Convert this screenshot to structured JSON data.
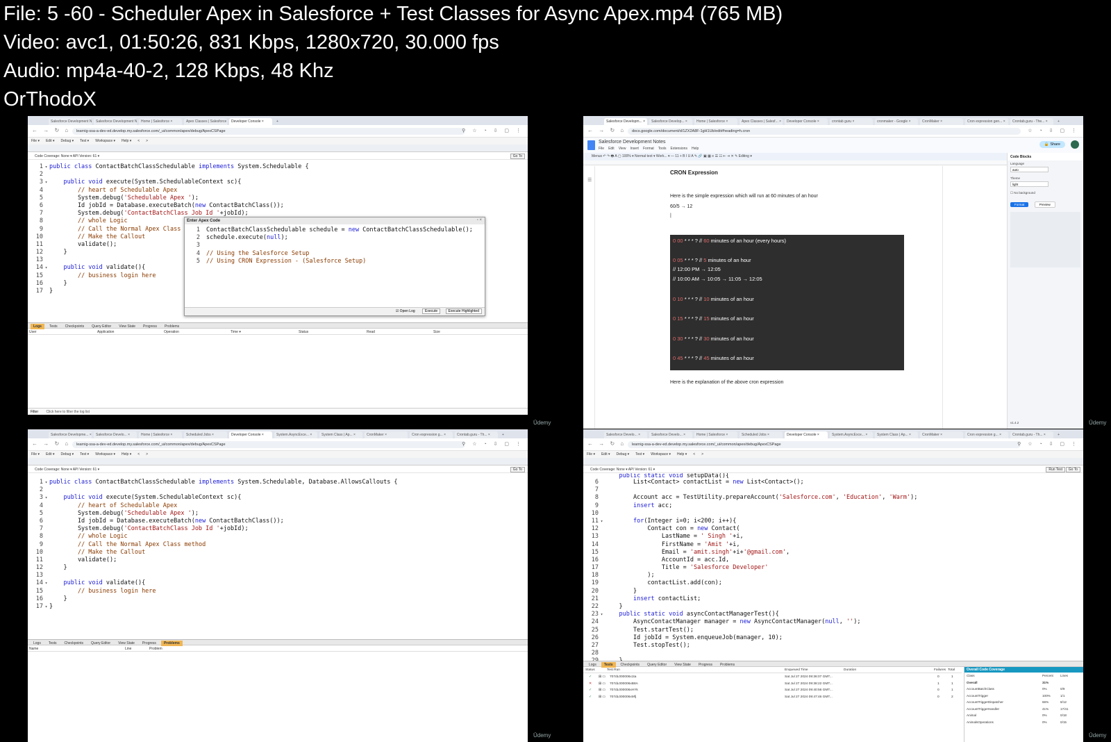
{
  "header": {
    "file": "File: 5 -60 - Scheduler Apex in Salesforce + Test Classes for Async Apex.mp4 (765 MB)",
    "video": "Video: avc1, 01:50:26, 831 Kbps, 1280x720, 30.000 fps",
    "audio": "Audio: mp4a-40-2, 128 Kbps, 48 Khz",
    "author": "OrThodoX"
  },
  "watermark": "Ūdemy",
  "console": {
    "url": "learnig-ssa-a-dev-ed.develop.my.salesforce.com/_ui/common/apex/debug/ApexCSPage",
    "menu": [
      "File ▾",
      "Edit ▾",
      "Debug ▾",
      "Test ▾",
      "Workspace ▾",
      "Help ▾",
      "<",
      ">"
    ],
    "coverage": "Code Coverage: None ▾   API Version:  61 ▾",
    "goto": "Go To",
    "run_test": "Run Test",
    "bottom_tabs": [
      "Logs",
      "Tests",
      "Checkpoints",
      "Query Editor",
      "View State",
      "Progress",
      "Problems"
    ]
  },
  "tl": {
    "tabs": [
      "Salesforce Development N...",
      "Salesforce Development Not...",
      "Home | Salesforce",
      "Apex Classes | Salesforce",
      "Developer Console"
    ],
    "files": [
      "AccountBatchClass.apex",
      "ContactBatchClass.apex",
      "AsyncContactManager.apex",
      "ContactBatchClassSchedulable.apex"
    ],
    "code": [
      {
        "n": "1",
        "f": "▾",
        "t": "<span class='kw'>public class</span> ContactBatchClassSchedulable <span class='kw'>implements</span> System.Schedulable {"
      },
      {
        "n": "2",
        "f": "",
        "t": ""
      },
      {
        "n": "3",
        "f": "▾",
        "t": "    <span class='kw'>public void</span> execute(System.SchedulableContext sc){"
      },
      {
        "n": "4",
        "f": "",
        "t": "        <span class='cm'>// heart of Schedulable Apex</span>"
      },
      {
        "n": "5",
        "f": "",
        "t": "        System.debug(<span class='st'>'Schedulable Apex '</span>);"
      },
      {
        "n": "6",
        "f": "",
        "t": "        Id jobId = Database.executeBatch(<span class='kw'>new</span> ContactBatchClass());"
      },
      {
        "n": "7",
        "f": "",
        "t": "        System.debug(<span class='st'>'ContactBatchClass Job Id '</span>+jobId);"
      },
      {
        "n": "8",
        "f": "",
        "t": "        <span class='cm'>// whole Logic</span>"
      },
      {
        "n": "9",
        "f": "",
        "t": "        <span class='cm'>// Call the Normal Apex Class m</span>"
      },
      {
        "n": "10",
        "f": "",
        "t": "        <span class='cm'>// Make the Callout</span>"
      },
      {
        "n": "11",
        "f": "",
        "t": "        validate();"
      },
      {
        "n": "12",
        "f": "",
        "t": "    }"
      },
      {
        "n": "13",
        "f": "",
        "t": ""
      },
      {
        "n": "14",
        "f": "▾",
        "t": "    <span class='kw'>public void</span> validate(){"
      },
      {
        "n": "15",
        "f": "",
        "t": "        <span class='cm'>// business login here</span>"
      },
      {
        "n": "16",
        "f": "",
        "t": "    }"
      },
      {
        "n": "17",
        "f": "",
        "t": "}"
      }
    ],
    "dialog": {
      "title": "Enter Apex Code",
      "code": [
        {
          "n": "1",
          "f": "",
          "t": "ContactBatchClassSchedulable schedule = <span class='kw'>new</span> ContactBatchClassSchedulable();"
        },
        {
          "n": "2",
          "f": "",
          "t": "schedule.execute(<span class='kw'>null</span>);"
        },
        {
          "n": "3",
          "f": "",
          "t": ""
        },
        {
          "n": "4",
          "f": "",
          "t": "<span class='cm'>// Using the Salesforce Setup</span>"
        },
        {
          "n": "5",
          "f": "",
          "t": "<span class='cm'>// Using CRON Expression - (Salesforce Setup)</span>"
        }
      ],
      "open_log": "☑ Open Log",
      "execute": "Execute",
      "execute_highlighted": "Execute Highlighted"
    },
    "log_cols": [
      "User",
      "Application",
      "Operation",
      "Time ▾",
      "Status",
      "Read",
      "Size"
    ],
    "filter": "Filter",
    "filter_hint": "Click here to filter the log list"
  },
  "tr": {
    "tabs": [
      "Salesforce Developm...",
      "Salesforce Develop...",
      "Home | Salesforce",
      "Apex Classes | Salesf...",
      "Developer Console",
      "crontab guru",
      "cronmaker - Google",
      "CronMaker",
      "Cron expression gen...",
      "Crontab.guru - The..."
    ],
    "url": "docs.google.com/document/d/1ZX2A8F-1gH1Ub/edit#heading=h.cron",
    "doc_title": "Salesforce Development Notes",
    "doc_menu": [
      "File",
      "Edit",
      "View",
      "Insert",
      "Format",
      "Tools",
      "Extensions",
      "Help"
    ],
    "share": "Share",
    "toolbar": "Menus   ↶  ↷  🖶  A  ▢   100% ▾    Normal text ▾    Work... ▾   — 11 +   B  I  U  A  ✎   🔗  ▣  ▦   ≡  ☰  ☷  ⇤  ⇥  ✕           ✎ Editing ▾",
    "heading": "CRON Expression",
    "p1": "Here is the simple expression which will run at 60 minutes of an hour",
    "p2": "60/5 → 12",
    "cron": [
      {
        "pre": "0 00",
        "mid": " * * * ? // ",
        "num": "60",
        "post": " minutes of an hour (every hours)"
      },
      {
        "pre": "0 05",
        "mid": " * * * ? // ",
        "num": "5",
        "post": " minutes of an hour"
      },
      {
        "pre": "",
        "mid": "// 12:00 PM → 12:05",
        "num": "",
        "post": ""
      },
      {
        "pre": "",
        "mid": "// 10:00 AM → 10:05 → 11:05 → 12:05",
        "num": "",
        "post": ""
      },
      {
        "pre": "0 10",
        "mid": " * * * ? // ",
        "num": "10",
        "post": " minutes of an hour"
      },
      {
        "pre": "0 15",
        "mid": " * * * ? // ",
        "num": "15",
        "post": " minutes of an hour"
      },
      {
        "pre": "0 30",
        "mid": " * * * ? // ",
        "num": "30",
        "post": " minutes of an hour"
      },
      {
        "pre": "0 45",
        "mid": " * * * ? // ",
        "num": "45",
        "post": " minutes of an hour"
      }
    ],
    "p3": "Here is the explanation of the above cron expression",
    "panel": {
      "title": "Code Blocks",
      "language_label": "Language",
      "language": "auto",
      "theme_label": "Theme",
      "theme": "light",
      "no_bg": "No background",
      "format": "Format",
      "preview": "Preview",
      "version": "v1.4.2"
    }
  },
  "bl": {
    "tabs": [
      "Salesforce Developme...",
      "Salesforce Develo...",
      "Home | Salesforce",
      "Scheduled Jobs",
      "Developer Console",
      "System.AsyncExce...",
      "System Class | Ap...",
      "CronMaker",
      "Cron expression g...",
      "Crontab.guru - Th..."
    ],
    "files": [
      "AccountBatchClass.apex",
      "ContactBatchClass.apex",
      "AsyncContactManager.apex",
      "ContactBatchClassSchedulable.apex"
    ],
    "code": [
      {
        "n": "1",
        "f": "▾",
        "t": "<span class='kw'>public class</span> ContactBatchClassSchedulable <span class='kw'>implements</span> System.Schedulable, Database.AllowsCallouts {"
      },
      {
        "n": "2",
        "f": "",
        "t": ""
      },
      {
        "n": "3",
        "f": "▾",
        "t": "    <span class='kw'>public void</span> execute(System.SchedulableContext sc){"
      },
      {
        "n": "4",
        "f": "",
        "t": "        <span class='cm'>// heart of Schedulable Apex</span>"
      },
      {
        "n": "5",
        "f": "",
        "t": "        System.debug(<span class='st'>'Schedulable Apex '</span>);"
      },
      {
        "n": "6",
        "f": "",
        "t": "        Id jobId = Database.executeBatch(<span class='kw'>new</span> ContactBatchClass());"
      },
      {
        "n": "7",
        "f": "",
        "t": "        System.debug(<span class='st'>'ContactBatchClass Job Id '</span>+jobId);"
      },
      {
        "n": "8",
        "f": "",
        "t": "        <span class='cm'>// whole Logic</span>"
      },
      {
        "n": "9",
        "f": "",
        "t": "        <span class='cm'>// Call the Normal Apex Class method</span>"
      },
      {
        "n": "10",
        "f": "",
        "t": "        <span class='cm'>// Make the Callout</span>"
      },
      {
        "n": "11",
        "f": "",
        "t": "        validate();"
      },
      {
        "n": "12",
        "f": "",
        "t": "    }"
      },
      {
        "n": "13",
        "f": "",
        "t": ""
      },
      {
        "n": "14",
        "f": "▾",
        "t": "    <span class='kw'>public void</span> validate(){"
      },
      {
        "n": "15",
        "f": "",
        "t": "        <span class='cm'>// business login here</span>"
      },
      {
        "n": "16",
        "f": "",
        "t": "    }"
      },
      {
        "n": "17",
        "f": "▾",
        "t": "}"
      }
    ],
    "problem_cols": [
      "Name",
      "Line",
      "Problem"
    ]
  },
  "br": {
    "tabs": [
      "Salesforce Develo...",
      "Salesforce Develo...",
      "Home | Salesforce",
      "Scheduled Jobs",
      "Developer Console",
      "System.AsyncExce...",
      "System Class | Ap...",
      "CronMaker",
      "Cron expression g...",
      "Crontab.guru - Th..."
    ],
    "files": [
      "AccountBatchClass.apex",
      "TestUtility.apex",
      "AsyncContactManager.apex",
      "AsyncContactManagerTest.apex"
    ],
    "code": [
      {
        "n": "6",
        "f": "",
        "t": "        List&lt;Contact&gt; contactList = <span class='kw'>new</span> List&lt;Contact&gt;();"
      },
      {
        "n": "7",
        "f": "",
        "t": ""
      },
      {
        "n": "8",
        "f": "",
        "t": "        Account acc = TestUtility.prepareAccount(<span class='st'>'Salesforce.com'</span>, <span class='st'>'Education'</span>, <span class='st'>'Warm'</span>);"
      },
      {
        "n": "9",
        "f": "",
        "t": "        <span class='kw'>insert</span> acc;"
      },
      {
        "n": "10",
        "f": "",
        "t": ""
      },
      {
        "n": "11",
        "f": "▾",
        "t": "        <span class='kw'>for</span>(Integer i=0; i&lt;200; i++){"
      },
      {
        "n": "12",
        "f": "",
        "t": "            Contact con = <span class='kw'>new</span> Contact("
      },
      {
        "n": "13",
        "f": "",
        "t": "                LastName = <span class='st'>' Singh '</span>+i,"
      },
      {
        "n": "14",
        "f": "",
        "t": "                FirstName = <span class='st'>'Amit '</span>+i,"
      },
      {
        "n": "15",
        "f": "",
        "t": "                Email = <span class='st'>'amit.singh'</span>+i+<span class='st'>'@gmail.com'</span>,"
      },
      {
        "n": "16",
        "f": "",
        "t": "                AccountId = acc.Id,"
      },
      {
        "n": "17",
        "f": "",
        "t": "                Title = <span class='st'>'Salesforce Developer'</span>"
      },
      {
        "n": "18",
        "f": "",
        "t": "            );"
      },
      {
        "n": "19",
        "f": "",
        "t": "            contactList.add(con);"
      },
      {
        "n": "20",
        "f": "",
        "t": "        }"
      },
      {
        "n": "21",
        "f": "",
        "t": "        <span class='kw'>insert</span> contactList;"
      },
      {
        "n": "22",
        "f": "",
        "t": "    }"
      },
      {
        "n": "23",
        "f": "▾",
        "t": "    <span class='kw'>public static void</span> asyncContactManagerTest(){"
      },
      {
        "n": "24",
        "f": "",
        "t": "        AsyncContactManager manager = <span class='kw'>new</span> AsyncContactManager(<span class='kw'>null</span>, <span class='st'>''</span>);"
      },
      {
        "n": "25",
        "f": "",
        "t": "        Test.startTest();"
      },
      {
        "n": "26",
        "f": "",
        "t": "        Id jobId = System.enqueueJob(manager, 10);"
      },
      {
        "n": "27",
        "f": "",
        "t": "        Test.stopTest();"
      },
      {
        "n": "28",
        "f": "",
        "t": ""
      },
      {
        "n": "29",
        "f": "",
        "t": "    }"
      }
    ],
    "test_cols": [
      "Status",
      "Test Run",
      "Enqueued Time",
      "Duration",
      "Failures",
      "Total"
    ],
    "tests": [
      {
        "status": "✓",
        "color": "#2e8b57",
        "run": "707dL000006x1ta",
        "time": "Sat Jul 27 2024 09:36:07 GMT...",
        "fail": "0",
        "total": "1"
      },
      {
        "status": "✕",
        "color": "#c62828",
        "run": "707dL000006xB8A",
        "time": "Sat Jul 27 2024 09:38:22 GMT...",
        "fail": "1",
        "total": "1"
      },
      {
        "status": "✓",
        "color": "#2e8b57",
        "run": "707dL000006xHYk",
        "time": "Sat Jul 27 2024 09:40:56 GMT...",
        "fail": "0",
        "total": "1"
      },
      {
        "status": "✓",
        "color": "#2e8b57",
        "run": "707dL000006xMfj",
        "time": "Sat Jul 27 2024 09:47:46 GMT...",
        "fail": "0",
        "total": "2"
      }
    ],
    "coverage": {
      "title": "Overall Code Coverage",
      "cols": [
        "Class",
        "Percent",
        "Lines"
      ],
      "rows": [
        {
          "c": "Overall",
          "p": "31%",
          "l": ""
        },
        {
          "c": "AccountBatchClass",
          "p": "0%",
          "l": "0/9"
        },
        {
          "c": "AccountTrigger",
          "p": "100%",
          "l": "1/1"
        },
        {
          "c": "AccountTriggerDispatcher",
          "p": "66%",
          "l": "8/12"
        },
        {
          "c": "AccountTriggerHandler",
          "p": "41%",
          "l": "17/41"
        },
        {
          "c": "Animal",
          "p": "0%",
          "l": "0/18"
        },
        {
          "c": "AnimalsOperations",
          "p": "0%",
          "l": "0/15"
        }
      ]
    }
  }
}
